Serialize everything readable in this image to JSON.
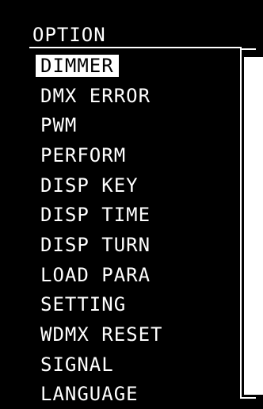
{
  "header": {
    "title": "OPTION"
  },
  "menu": {
    "selected_index": 0,
    "items": [
      {
        "label": "DIMMER"
      },
      {
        "label": "DMX ERROR"
      },
      {
        "label": "PWM"
      },
      {
        "label": "PERFORM"
      },
      {
        "label": "DISP KEY"
      },
      {
        "label": "DISP TIME"
      },
      {
        "label": "DISP TURN"
      },
      {
        "label": "LOAD PARA"
      },
      {
        "label": "SETTING"
      },
      {
        "label": "WDMX RESET"
      },
      {
        "label": "SIGNAL"
      },
      {
        "label": "LANGUAGE"
      }
    ]
  },
  "colors": {
    "background": "#000000",
    "foreground": "#ffffff",
    "highlight_background": "#ffffff",
    "highlight_text": "#000000"
  }
}
